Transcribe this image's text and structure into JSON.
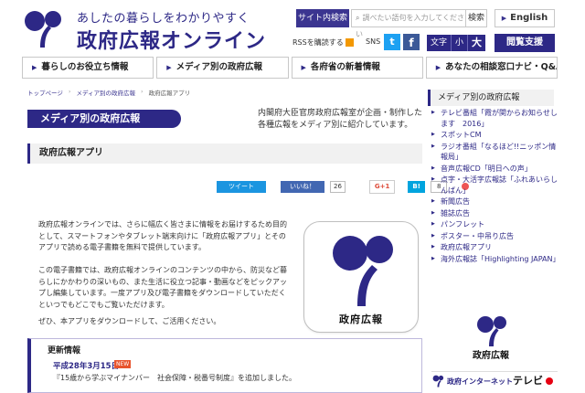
{
  "header": {
    "tagline": "あしたの暮らしをわかりやすく",
    "site_name": "政府広報オンライン",
    "search_label": "サイト内検索",
    "search_placeholder": "調べたい語句を入力してください",
    "search_button": "検索",
    "english_label": "English",
    "rss_label": "RSSを購読する",
    "sns_label": "SNS",
    "textsize": {
      "label": "文字",
      "small": "小",
      "large": "大"
    },
    "reading_label": "閲覧支援"
  },
  "nav": [
    {
      "label": "暮らしのお役立ち情報"
    },
    {
      "label": "メディア別の政府広報"
    },
    {
      "label": "各府省の新着情報"
    },
    {
      "label": "あなたの相談窓口ナビ・Q&A"
    }
  ],
  "breadcrumb": [
    "トップページ",
    "メディア別の政府広報",
    "政府広報アプリ"
  ],
  "main": {
    "media_heading": "メディア別の政府広報",
    "media_desc": "内閣府大臣官房政府広報室が企画・制作した各種広報をメディア別に紹介しています。",
    "page_title": "政府広報アプリ",
    "share": {
      "tweet": "ツイート",
      "like": "いいね！",
      "like_count": "26",
      "gplus": "G+1",
      "hatena": "B!",
      "hatena_count": "8"
    },
    "paragraphs": [
      "政府広報オンラインでは、さらに幅広く皆さまに情報をお届けするため目的として、スマートフォンやタブレット端末向けに「政府広報アプリ」とそのアプリで読める電子書籍を無料で提供しています。",
      "この電子書籍では、政府広報オンラインのコンテンツの中から、防災など暮らしにかかわりの深いもの、また生活に役立つ記事・動画などをピックアップし編集しています。一度アプリ及び電子書籍をダウンロードしていただくといつでもどこでもご覧いただけます。",
      "ぜひ、本アプリをダウンロードして、ご活用ください。"
    ],
    "app_icon_label": "政府広報",
    "updates": {
      "heading": "更新情報",
      "date": "平成28年3月15日",
      "badge": "NEW",
      "text": "『15歳から学ぶマイナンバー　社会保障・税番号制度』を追加しました。"
    }
  },
  "sidebar": {
    "heading": "メディア別の政府広報",
    "items": [
      {
        "label": "テレビ番組「霞が関からお知らせします　2016」"
      },
      {
        "label": "スポットCM"
      },
      {
        "label": "ラジオ番組「なるほど!!ニッポン情報局」"
      },
      {
        "label": "音声広報CD「明日への声」"
      },
      {
        "label": "点字・大活字広報誌「ふれあいらしんばん」"
      },
      {
        "label": "新聞広告"
      },
      {
        "label": "雑誌広告"
      },
      {
        "label": "パンフレット"
      },
      {
        "label": "ポスター・中吊り広告"
      },
      {
        "label": "政府広報アプリ"
      },
      {
        "label": "海外広報誌「Highlighting JAPAN」"
      }
    ],
    "logo_label": "政府広報",
    "tv_banner": {
      "prefix": "政府インターネット",
      "suffix": "テレビ"
    }
  },
  "colors": {
    "brand": "#2d2886",
    "twitter": "#1da1f2",
    "facebook": "#3b5998",
    "new_badge": "#e8542d"
  }
}
